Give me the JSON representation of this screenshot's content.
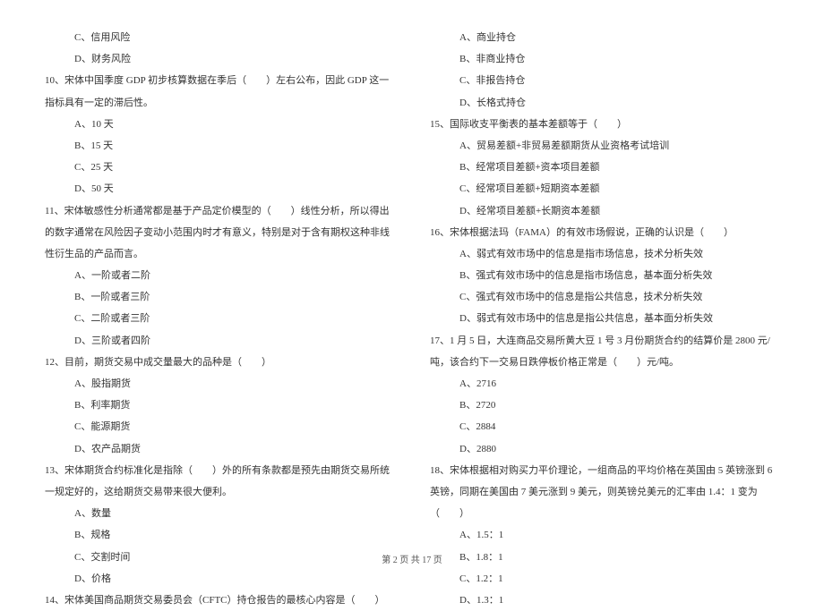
{
  "left": {
    "opt_c_prev": "C、信用风险",
    "opt_d_prev": "D、财务风险",
    "q10": "10、宋体中国季度 GDP 初步核算数据在季后（　　）左右公布，因此 GDP 这一指标具有一定的滞后性。",
    "q10_a": "A、10 天",
    "q10_b": "B、15 天",
    "q10_c": "C、25 天",
    "q10_d": "D、50 天",
    "q11": "11、宋体敏感性分析通常都是基于产品定价模型的（　　）线性分析，所以得出的数字通常在风险因子变动小范围内时才有意义，特别是对于含有期权这种非线性衍生品的产品而言。",
    "q11_a": "A、一阶或者二阶",
    "q11_b": "B、一阶或者三阶",
    "q11_c": "C、二阶或者三阶",
    "q11_d": "D、三阶或者四阶",
    "q12": "12、目前，期货交易中成交量最大的品种是（　　）",
    "q12_a": "A、股指期货",
    "q12_b": "B、利率期货",
    "q12_c": "C、能源期货",
    "q12_d": "D、农产品期货",
    "q13": "13、宋体期货合约标准化是指除（　　）外的所有条款都是预先由期货交易所统一规定好的，这给期货交易带来很大便利。",
    "q13_a": "A、数量",
    "q13_b": "B、规格",
    "q13_c": "C、交割时间",
    "q13_d": "D、价格",
    "q14": "14、宋体美国商品期货交易委员会（CFTC）持仓报告的最核心内容是（　　）"
  },
  "right": {
    "q14_a": "A、商业持仓",
    "q14_b": "B、非商业持仓",
    "q14_c": "C、非报告持仓",
    "q14_d": "D、长格式持仓",
    "q15": "15、国际收支平衡表的基本差额等于（　　）",
    "q15_a": "A、贸易差额+非贸易差额期货从业资格考试培训",
    "q15_b": "B、经常项目差额+资本项目差额",
    "q15_c": "C、经常项目差额+短期资本差额",
    "q15_d": "D、经常项目差额+长期资本差额",
    "q16": "16、宋体根据法玛（FAMA）的有效市场假说，正确的认识是（　　）",
    "q16_a": "A、弱式有效市场中的信息是指市场信息，技术分析失效",
    "q16_b": "B、强式有效市场中的信息是指市场信息，基本面分析失效",
    "q16_c": "C、强式有效市场中的信息是指公共信息，技术分析失效",
    "q16_d": "D、弱式有效市场中的信息是指公共信息，基本面分析失效",
    "q17": "17、1 月 5 日，大连商品交易所黄大豆 1 号 3 月份期货合约的结算价是 2800 元/吨，该合约下一交易日跌停板价格正常是（　　）元/吨。",
    "q17_a": "A、2716",
    "q17_b": "B、2720",
    "q17_c": "C、2884",
    "q17_d": "D、2880",
    "q18": "18、宋体根据相对购买力平价理论，一组商品的平均价格在英国由 5 英镑涨到 6 英镑，同期在美国由 7 美元涨到 9 美元，则英镑兑美元的汇率由 1.4：1 变为（　　）",
    "q18_a": "A、1.5：1",
    "q18_b": "B、1.8：1",
    "q18_c": "C、1.2：1",
    "q18_d": "D、1.3：1"
  },
  "footer": "第 2 页 共 17 页"
}
